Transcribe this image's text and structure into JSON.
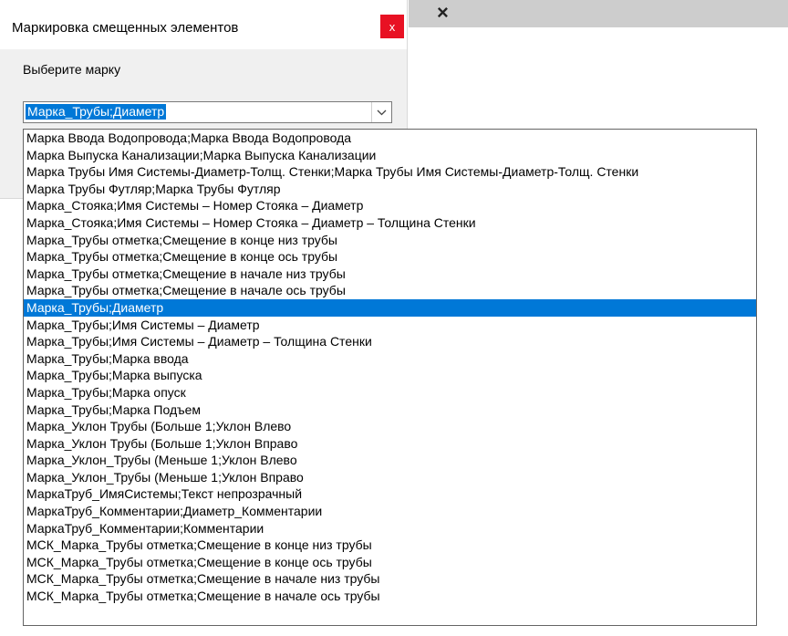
{
  "background": {
    "close_glyph": "×"
  },
  "dialog": {
    "title": "Маркировка смещенных элементов",
    "close_glyph": "x",
    "prompt": "Выберите марку",
    "combo_value": "Марка_Трубы;Диаметр",
    "accent_color": "#0078d7",
    "close_color": "#e81123"
  },
  "dropdown": {
    "selected_index": 10,
    "options": [
      "Марка Ввода Водопровода;Марка Ввода Водопровода",
      "Марка Выпуска Канализации;Марка Выпуска Канализации",
      "Марка Трубы Имя Системы-Диаметр-Толщ. Стенки;Марка Трубы Имя Системы-Диаметр-Толщ. Стенки",
      "Марка Трубы Футляр;Марка Трубы Футляр",
      "Марка_Стояка;Имя Системы – Номер Стояка – Диаметр",
      "Марка_Стояка;Имя Системы – Номер Стояка – Диаметр – Толщина Стенки",
      "Марка_Трубы отметка;Смещение в конце низ трубы",
      "Марка_Трубы отметка;Смещение в конце ось трубы",
      "Марка_Трубы отметка;Смещение в начале низ трубы",
      "Марка_Трубы отметка;Смещение в начале ось трубы",
      "Марка_Трубы;Диаметр",
      "Марка_Трубы;Имя Системы – Диаметр",
      "Марка_Трубы;Имя Системы – Диаметр – Толщина Стенки",
      "Марка_Трубы;Марка ввода",
      "Марка_Трубы;Марка выпуска",
      "Марка_Трубы;Марка опуск",
      "Марка_Трубы;Марка Подъем",
      "Марка_Уклон Трубы (Больше 1;Уклон Влево",
      "Марка_Уклон Трубы (Больше 1;Уклон Вправо",
      "Марка_Уклон_Трубы (Меньше 1;Уклон Влево",
      "Марка_Уклон_Трубы (Меньше 1;Уклон Вправо",
      "МаркаТруб_ИмяСистемы;Текст непрозрачный",
      "МаркаТруб_Комментарии;Диаметр_Комментарии",
      "МаркаТруб_Комментарии;Комментарии",
      "МСК_Марка_Трубы отметка;Смещение в конце низ трубы",
      "МСК_Марка_Трубы отметка;Смещение в конце ось трубы",
      "МСК_Марка_Трубы отметка;Смещение в начале низ трубы",
      "МСК_Марка_Трубы отметка;Смещение в начале ось трубы"
    ]
  }
}
